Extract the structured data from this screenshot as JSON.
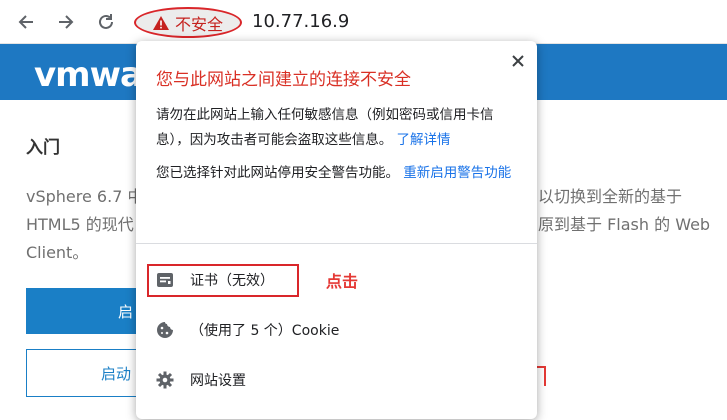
{
  "browser": {
    "security_chip": "不安全",
    "url": "10.77.16.9"
  },
  "background_page": {
    "logo": "vmwa",
    "title": "入门",
    "lines": [
      "vSphere 6.7 中",
      "HTML5 的现代",
      "Client。"
    ],
    "right_lines": [
      "以切换到全新的基于",
      "原到基于 Flash 的 Web"
    ],
    "button_primary": "启",
    "button_secondary": "启动"
  },
  "popup": {
    "title": "您与此网站之间建立的连接不安全",
    "p1_text": "请勿在此网站上输入任何敏感信息（例如密码或信用卡信息），因为攻击者可能会盗取这些信息。",
    "p1_link": "了解详情",
    "p2_text": "您已选择针对此网站停用安全警告功能。",
    "p2_link": "重新启用警告功能",
    "items": [
      {
        "label": "证书（无效）",
        "icon": "certificate-icon"
      },
      {
        "label": "（使用了 5 个）Cookie",
        "icon": "cookie-icon"
      },
      {
        "label": "网站设置",
        "icon": "gear-icon"
      }
    ],
    "annotation": "点击"
  }
}
